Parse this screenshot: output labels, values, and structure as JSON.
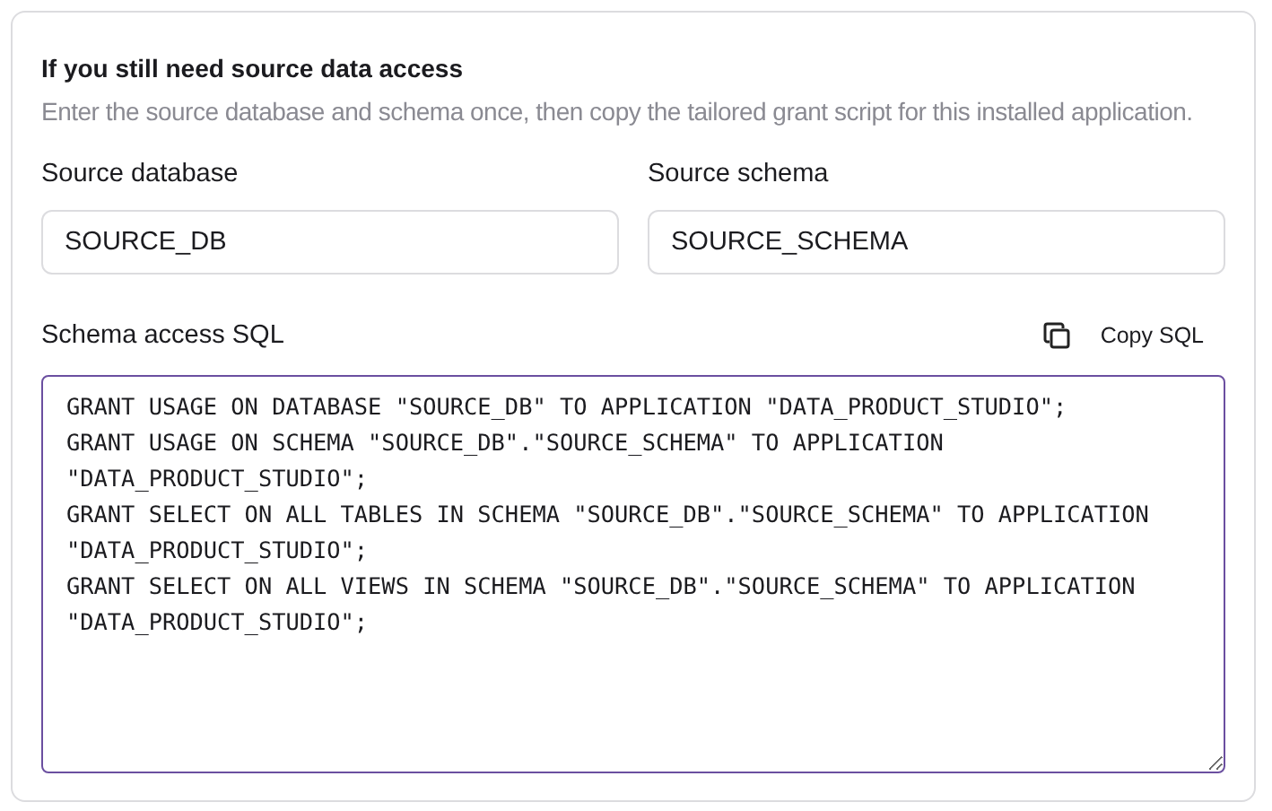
{
  "section": {
    "title": "If you still need source data access",
    "description": "Enter the source database and schema once, then copy the tailored grant script for this installed application."
  },
  "fields": [
    {
      "label": "Source database",
      "value": "SOURCE_DB"
    },
    {
      "label": "Source schema",
      "value": "SOURCE_SCHEMA"
    }
  ],
  "sql": {
    "label": "Schema access SQL",
    "copy_button": "Copy SQL",
    "statements": [
      "GRANT USAGE ON DATABASE \"SOURCE_DB\" TO APPLICATION \"DATA_PRODUCT_STUDIO\";",
      "GRANT USAGE ON SCHEMA \"SOURCE_DB\".\"SOURCE_SCHEMA\" TO APPLICATION \"DATA_PRODUCT_STUDIO\";",
      "GRANT SELECT ON ALL TABLES IN SCHEMA \"SOURCE_DB\".\"SOURCE_SCHEMA\" TO APPLICATION \"DATA_PRODUCT_STUDIO\";",
      "GRANT SELECT ON ALL VIEWS IN SCHEMA \"SOURCE_DB\".\"SOURCE_SCHEMA\" TO APPLICATION \"DATA_PRODUCT_STUDIO\";"
    ]
  }
}
